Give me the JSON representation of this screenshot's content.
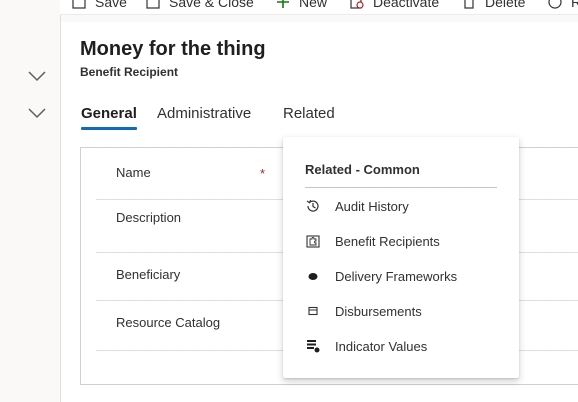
{
  "commandbar": {
    "items": [
      {
        "label": "Save",
        "icon": "save-icon"
      },
      {
        "label": "Save & Close",
        "icon": "save-close-icon"
      },
      {
        "label": "New",
        "icon": "plus-icon"
      },
      {
        "label": "Deactivate",
        "icon": "deactivate-icon"
      },
      {
        "label": "Delete",
        "icon": "trash-icon"
      },
      {
        "label": "R",
        "icon": "refresh-icon"
      }
    ]
  },
  "record": {
    "title": "Money for the thing",
    "entity": "Benefit Recipient"
  },
  "tabs": [
    {
      "label": "General",
      "active": true
    },
    {
      "label": "Administrative",
      "active": false
    },
    {
      "label": "Related",
      "active": false
    }
  ],
  "form": {
    "fields": [
      {
        "label": "Name",
        "required_marker": "*"
      },
      {
        "label": "Description"
      },
      {
        "label": "Beneficiary"
      },
      {
        "label": "Resource Catalog"
      }
    ]
  },
  "related_menu": {
    "header": "Related - Common",
    "items": [
      {
        "label": "Audit History",
        "icon": "history-icon"
      },
      {
        "label": "Benefit Recipients",
        "icon": "puzzle-icon"
      },
      {
        "label": "Delivery Frameworks",
        "icon": "blob-icon"
      },
      {
        "label": "Disbursements",
        "icon": "box-icon"
      },
      {
        "label": "Indicator Values",
        "icon": "indicator-icon"
      }
    ]
  },
  "colors": {
    "accent": "#0f6cbd",
    "required": "#a4262c",
    "new_icon": "#107c10"
  }
}
